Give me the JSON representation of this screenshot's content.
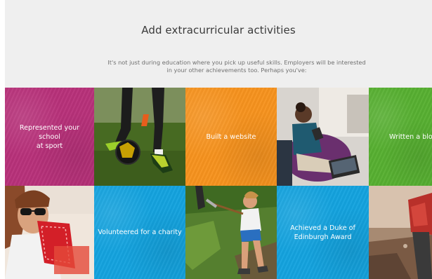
{
  "section": {
    "title": "Add extracurricular activities",
    "intro": "It's not just during education where you pick up useful skills. Employers will be interested\nin your other achievements too. Perhaps you've:"
  },
  "tiles": [
    {
      "label": "Represented your school\nat sport",
      "color": "#b8317a"
    },
    {
      "label": "Built a website",
      "color": "#f7931e"
    },
    {
      "label": "Written a blo",
      "color": "#57b031"
    },
    {
      "label": "Volunteered for a charity",
      "color": "#14a3df"
    },
    {
      "label": "Achieved a Duke of\nEdinburgh Award",
      "color": "#14a3df"
    }
  ],
  "photos": [
    {
      "name": "football-photo"
    },
    {
      "name": "student-tablet-photo"
    },
    {
      "name": "sunglasses-laptop-photo"
    },
    {
      "name": "gardening-volunteer-photo"
    },
    {
      "name": "hiker-photo"
    }
  ]
}
